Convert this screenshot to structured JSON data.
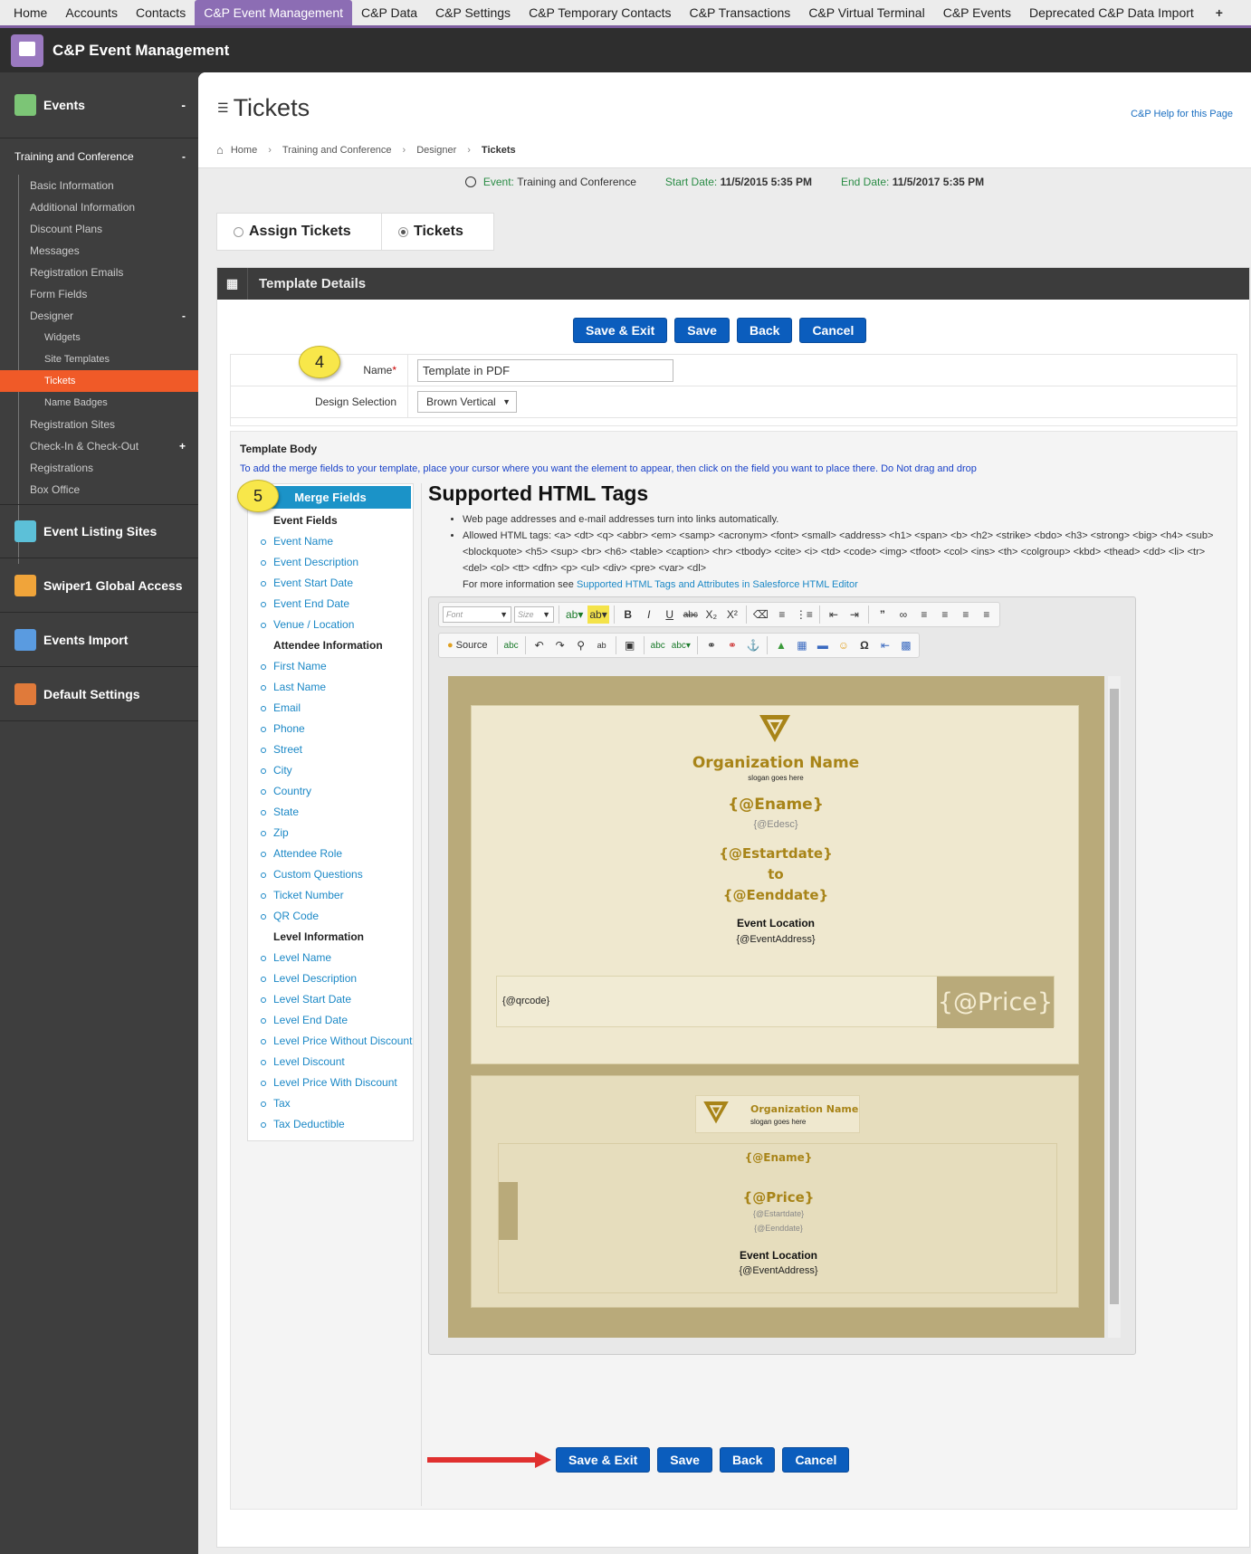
{
  "topnav": {
    "tabs": [
      "Home",
      "Accounts",
      "Contacts",
      "C&P Event Management",
      "C&P Data",
      "C&P Settings",
      "C&P Temporary Contacts",
      "C&P Transactions",
      "C&P Virtual Terminal",
      "C&P Events",
      "Deprecated C&P Data Import"
    ],
    "active": "C&P Event Management",
    "plus": "+"
  },
  "app": {
    "title": "C&P Event Management"
  },
  "sidebar": {
    "events_label": "Events",
    "events_toggle": "-",
    "event_name": "Training and Conference",
    "event_toggle": "-",
    "items": [
      "Basic Information",
      "Additional Information",
      "Discount Plans",
      "Messages",
      "Registration Emails",
      "Form Fields"
    ],
    "designer": "Designer",
    "designer_toggle": "-",
    "designer_items": [
      "Widgets",
      "Site Templates",
      "Tickets",
      "Name Badges"
    ],
    "after_items": [
      "Registration Sites"
    ],
    "checkin": "Check-In & Check-Out",
    "checkin_toggle": "+",
    "tail_items": [
      "Registrations",
      "Box Office"
    ],
    "sections": [
      "Event Listing Sites",
      "Swiper1 Global Access",
      "Events Import",
      "Default Settings"
    ]
  },
  "page": {
    "title": "Tickets",
    "help": "C&P Help for this Page",
    "breadcrumbs": [
      "Home",
      "Training and Conference",
      "Designer",
      "Tickets"
    ]
  },
  "event_info": {
    "event_label": "Event:",
    "event_name": "Training and Conference",
    "start_label": "Start Date:",
    "start": "11/5/2015 5:35 PM",
    "end_label": "End Date:",
    "end": "11/5/2017 5:35 PM"
  },
  "tabs": {
    "assign": "Assign Tickets",
    "tickets": "Tickets"
  },
  "panel": {
    "title": "Template Details"
  },
  "buttons": {
    "save_exit": "Save & Exit",
    "save": "Save",
    "back": "Back",
    "cancel": "Cancel"
  },
  "form": {
    "name_label": "Name",
    "name_required": "*",
    "name_value": "Template in PDF",
    "design_label": "Design Selection",
    "design_value": "Brown Vertical"
  },
  "callouts": {
    "c4": "4",
    "c5": "5"
  },
  "template_body": {
    "title": "Template Body",
    "instructions": "To add the merge fields to your template, place your cursor where you want the element to appear, then click on the field you want to place there. Do Not drag and drop"
  },
  "merge_fields": {
    "header": "Merge Fields",
    "event_group": "Event Fields",
    "event_items": [
      "Event Name",
      "Event Description",
      "Event Start Date",
      "Event End Date",
      "Venue / Location"
    ],
    "attendee_group": "Attendee Information",
    "attendee_items": [
      "First Name",
      "Last Name",
      "Email",
      "Phone",
      "Street",
      "City",
      "Country",
      "State",
      "Zip",
      "Attendee Role",
      "Custom Questions",
      "Ticket Number",
      "QR Code"
    ],
    "level_group": "Level Information",
    "level_items": [
      "Level Name",
      "Level Description",
      "Level Start Date",
      "Level End Date",
      "Level Price Without Discount",
      "Level Discount",
      "Level Price With Discount",
      "Tax",
      "Tax Deductible"
    ]
  },
  "supported": {
    "title": "Supported HTML Tags",
    "bullet1": "Web page addresses and e-mail addresses turn into links automatically.",
    "bullet2": "Allowed HTML tags: <a> <dt> <q> <abbr> <em> <samp> <acronym> <font> <small> <address> <h1> <span> <b> <h2> <strike> <bdo> <h3> <strong> <big> <h4> <sub> <blockquote> <h5> <sup> <br> <h6> <table> <caption> <hr> <tbody> <cite> <i> <td> <code> <img> <tfoot> <col> <ins> <th> <colgroup> <kbd> <thead> <dd> <li> <tr> <del> <ol> <tt> <dfn> <p> <ul> <div> <pre> <var> <dl>",
    "more_prefix": "For more information see ",
    "more_link": "Supported HTML Tags and Attributes in Salesforce HTML Editor"
  },
  "editor": {
    "font_placeholder": "Font",
    "size_placeholder": "Size",
    "source": "Source"
  },
  "ticket1": {
    "org": "Organization Name",
    "slogan": "slogan goes here",
    "ename": "{@Ename}",
    "edesc": "{@Edesc}",
    "start": "{@Estartdate}",
    "to": "to",
    "end": "{@Eenddate}",
    "loc_label": "Event Location",
    "address": "{@EventAddress}",
    "qrcode": "{@qrcode}",
    "price": "{@Price}"
  },
  "ticket2": {
    "org": "Organization Name",
    "slogan": "slogan goes here",
    "ename": "{@Ename}",
    "price": "{@Price}",
    "start": "{@Estartdate}",
    "end": "{@Eenddate}",
    "loc_label": "Event Location",
    "address": "{@EventAddress}"
  },
  "colors": {
    "accent": "#8c6db4",
    "sidebar_active": "#f05a28",
    "button": "#0b5dbd",
    "merge_header": "#1b93c8",
    "ticket_gold": "#b9aa7a"
  }
}
